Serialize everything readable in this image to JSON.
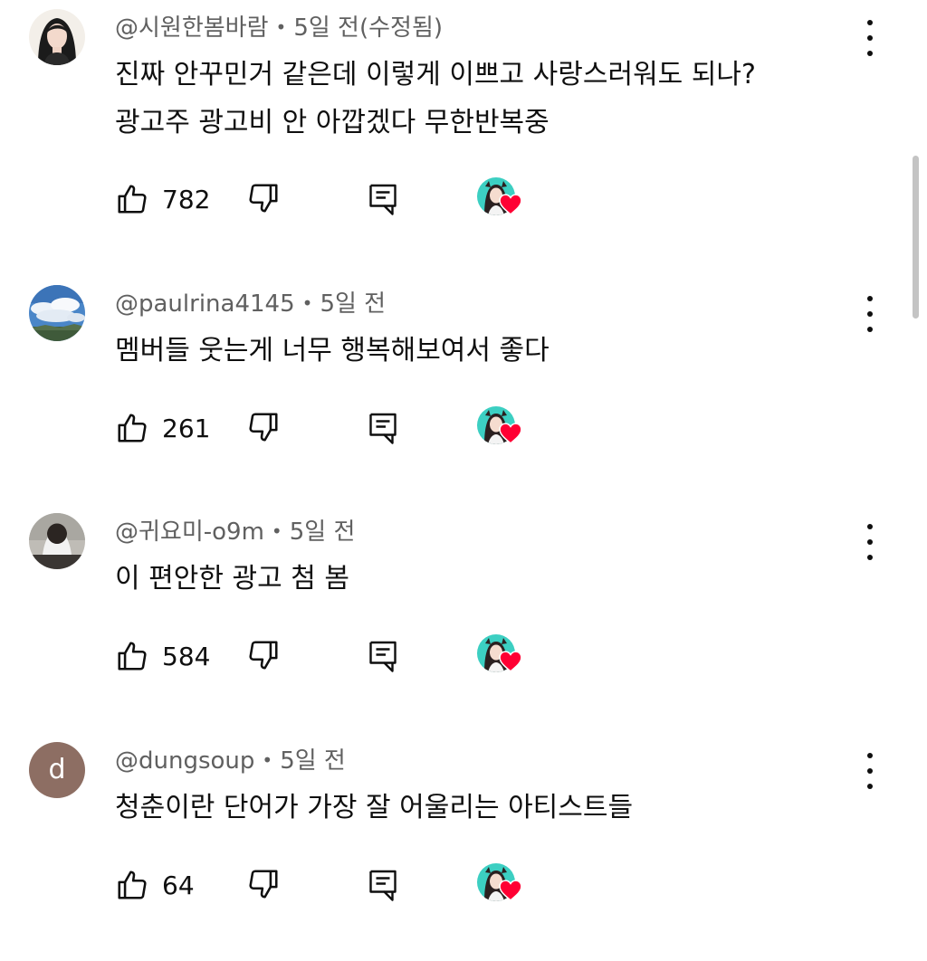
{
  "comments": [
    {
      "author": "@시원한봄바람",
      "time": "5일 전(수정됨)",
      "lines": [
        "진짜 안꾸민거 같은데 이렇게 이쁘고 사랑스러워도 되나?",
        "광고주 광고비 안 아깝겠다 무한반복중"
      ],
      "likes": "782",
      "avatar_icon": "profile-photo",
      "creator_hearted": true
    },
    {
      "author": "@paulrina4145",
      "time": "5일 전",
      "lines": [
        "멤버들 웃는게 너무 행복해보여서 좋다"
      ],
      "likes": "261",
      "avatar_icon": "sky-photo",
      "creator_hearted": true
    },
    {
      "author": "@귀요미-o9m",
      "time": "5일 전",
      "lines": [
        "이 편안한 광고 첨 봄"
      ],
      "likes": "584",
      "avatar_icon": "profile-photo",
      "creator_hearted": true
    },
    {
      "author": "@dungsoup",
      "time": "5일 전",
      "lines": [
        "청춘이란 단어가 가장 잘 어울리는 아티스트들"
      ],
      "likes": "64",
      "avatar_letter": "d",
      "avatar_color": "#8d6e63",
      "creator_hearted": true
    }
  ],
  "separator": "•",
  "colors": {
    "heart": "#ff0033",
    "meta_text": "#606060",
    "creator_avatar_bg": "#3ccfc2"
  },
  "icons": {
    "like": "thumbs-up-icon",
    "dislike": "thumbs-down-icon",
    "reply": "reply-comment-icon",
    "more": "more-vertical-icon",
    "heart": "creator-heart-icon"
  }
}
